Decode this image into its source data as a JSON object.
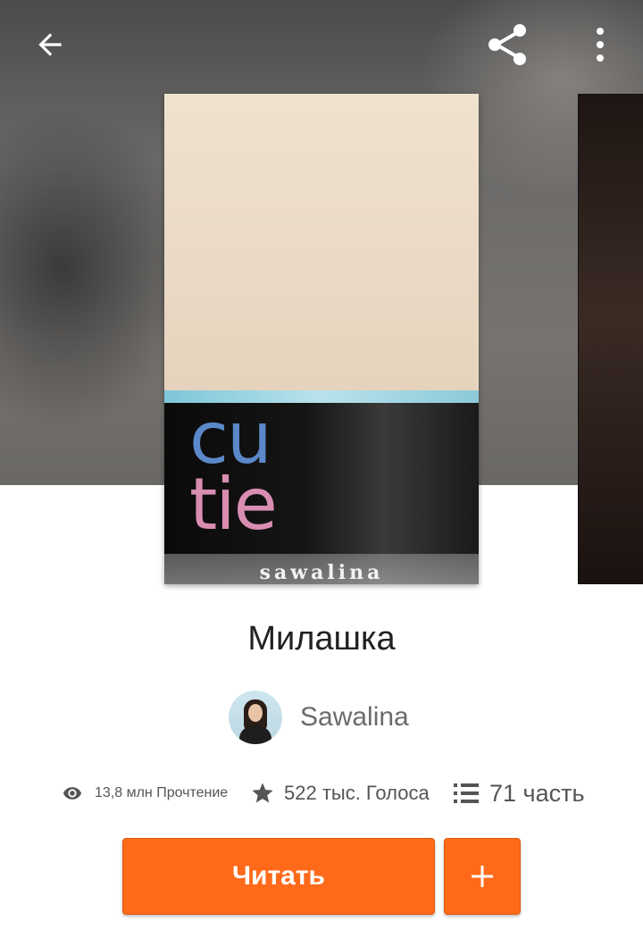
{
  "toolbar": {
    "back_icon": "arrow-left-icon",
    "share_icon": "share-icon",
    "more_icon": "more-vertical-icon"
  },
  "cover": {
    "title_line1": "cu",
    "title_line2": "tie",
    "author": "sawalina"
  },
  "story": {
    "title": "Милашка",
    "author_name": "Sawalina"
  },
  "stats": {
    "reads": "13,8 млн Прочтение",
    "votes": "522 тыс. Голоса",
    "parts": "71 часть"
  },
  "actions": {
    "read_label": "Читать",
    "add_icon": "plus-icon"
  },
  "colors": {
    "accent": "#ff6a1a",
    "icon_light": "#ffffff",
    "stat_icon": "#555555"
  }
}
